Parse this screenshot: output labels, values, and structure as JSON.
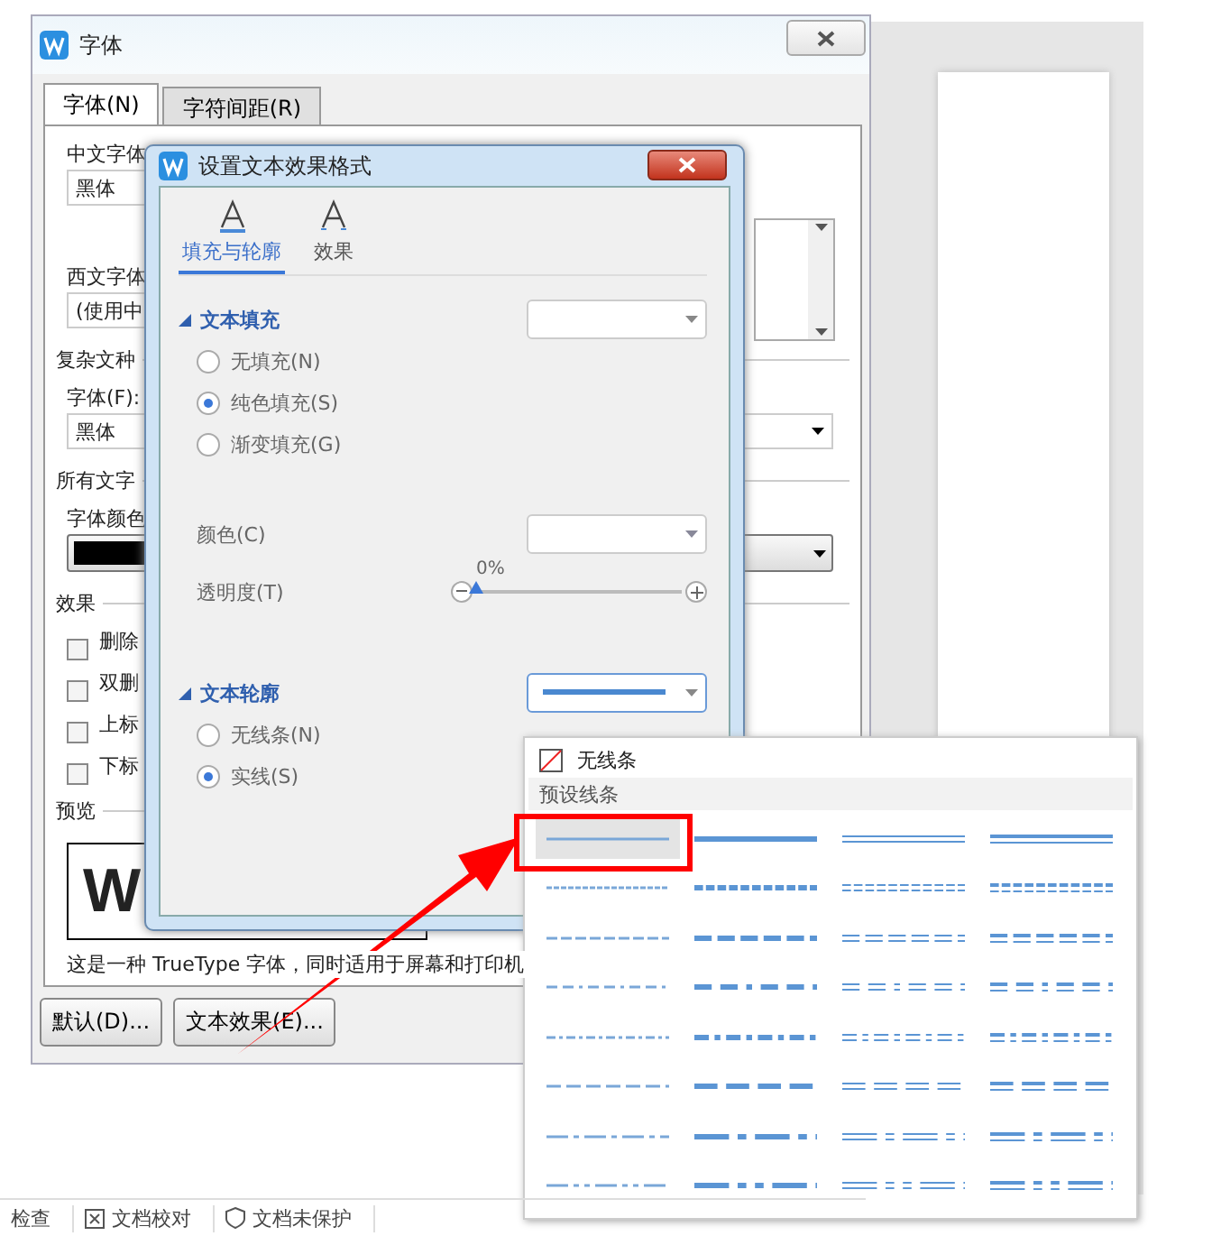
{
  "back_window": {
    "title": "字体",
    "tabs": [
      {
        "label": "字体(N)",
        "selected": true
      },
      {
        "label": "字符间距(R)",
        "selected": false
      }
    ],
    "chinese_font": {
      "label": "中文字体",
      "value": "黑体"
    },
    "western_font": {
      "label": "西文字体",
      "value": "(使用中"
    },
    "complex_group": "复杂文种",
    "complex_font": {
      "label": "字体(F):",
      "value": "黑体"
    },
    "all_text_group": "所有文字",
    "font_color_label": "字体颜色",
    "effects_group": "效果",
    "effects": [
      {
        "label": "删除",
        "checked": false
      },
      {
        "label": "双删",
        "checked": false
      },
      {
        "label": "上标",
        "checked": false
      },
      {
        "label": "下标",
        "checked": false
      }
    ],
    "preview_group": "预览",
    "preview_text": "W",
    "description": "这是一种 TrueType 字体，同时适用于屏幕和打印机",
    "buttons": [
      "默认(D)...",
      "文本效果(E)..."
    ]
  },
  "dialog": {
    "title": "设置文本效果格式",
    "tabs": [
      {
        "label": "填充与轮廓",
        "selected": true
      },
      {
        "label": "效果",
        "selected": false
      }
    ],
    "fill_section": "文本填充",
    "fill_options": [
      {
        "label": "无填充(N)",
        "selected": false
      },
      {
        "label": "纯色填充(S)",
        "selected": true
      },
      {
        "label": "渐变填充(G)",
        "selected": false
      }
    ],
    "color_label": "颜色(C)",
    "transparency": {
      "label": "透明度(T)",
      "reading": "0%",
      "level": 0
    },
    "outline_section": "文本轮廓",
    "outline_options": [
      {
        "label": "无线条(N)",
        "selected": false
      },
      {
        "label": "实线(S)",
        "selected": true
      }
    ]
  },
  "line_menu": {
    "no_line": "无线条",
    "header": "预设线条",
    "presets": [
      {
        "selected": true
      },
      {
        "selected": false
      },
      {
        "selected": false
      },
      {
        "selected": false
      },
      {
        "selected": false
      },
      {
        "selected": false
      },
      {
        "selected": false
      },
      {
        "selected": false
      },
      {
        "selected": false
      },
      {
        "selected": false
      },
      {
        "selected": false
      },
      {
        "selected": false
      },
      {
        "selected": false
      },
      {
        "selected": false
      },
      {
        "selected": false
      },
      {
        "selected": false
      },
      {
        "selected": false
      },
      {
        "selected": false
      },
      {
        "selected": false
      },
      {
        "selected": false
      },
      {
        "selected": false
      },
      {
        "selected": false
      },
      {
        "selected": false
      },
      {
        "selected": false
      },
      {
        "selected": false
      },
      {
        "selected": false
      },
      {
        "selected": false
      },
      {
        "selected": false
      },
      {
        "selected": false
      },
      {
        "selected": false
      },
      {
        "selected": false
      },
      {
        "selected": false
      }
    ]
  },
  "status_bar": [
    "检查",
    "文档校对",
    "文档未保护"
  ]
}
